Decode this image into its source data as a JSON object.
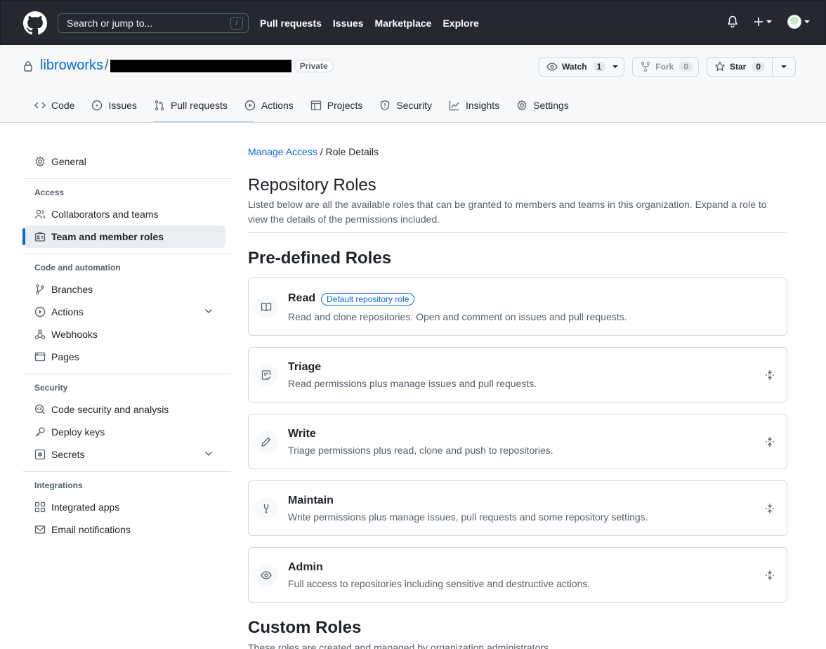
{
  "topbar": {
    "search_placeholder": "Search or jump to...",
    "search_shortcut": "/",
    "nav": [
      "Pull requests",
      "Issues",
      "Marketplace",
      "Explore"
    ],
    "icons": [
      "github-logo-icon",
      "bell-icon",
      "plus-icon",
      "avatar"
    ]
  },
  "repo": {
    "owner": "libroworks",
    "separator": "/",
    "visibility": "Private",
    "watch_label": "Watch",
    "watch_count": "1",
    "fork_label": "Fork",
    "fork_count": "0",
    "star_label": "Star",
    "star_count": "0"
  },
  "tabs": [
    "Code",
    "Issues",
    "Pull requests",
    "Actions",
    "Projects",
    "Security",
    "Insights",
    "Settings"
  ],
  "sidebar": {
    "general": "General",
    "access_heading": "Access",
    "collaborators": "Collaborators and teams",
    "team_roles": "Team and member roles",
    "code_heading": "Code and automation",
    "branches": "Branches",
    "actions": "Actions",
    "webhooks": "Webhooks",
    "pages": "Pages",
    "security_heading": "Security",
    "code_security": "Code security and analysis",
    "deploy_keys": "Deploy keys",
    "secrets": "Secrets",
    "integrations_heading": "Integrations",
    "integrated_apps": "Integrated apps",
    "email_notifications": "Email notifications"
  },
  "main": {
    "breadcrumb_link": "Manage Access",
    "breadcrumb_sep": " / ",
    "breadcrumb_current": "Role Details",
    "title": "Repository Roles",
    "description": "Listed below are all the available roles that can be granted to members and teams in this organization. Expand a role to view the details of the permissions included.",
    "predefined_heading": "Pre-defined Roles",
    "roles": [
      {
        "name": "Read",
        "badge": "Default repository role",
        "desc": "Read and clone repositories. Open and comment on issues and pull requests.",
        "icon": "book-icon"
      },
      {
        "name": "Triage",
        "desc": "Read permissions plus manage issues and pull requests.",
        "icon": "triage-icon"
      },
      {
        "name": "Write",
        "desc": "Triage permissions plus read, clone and push to repositories.",
        "icon": "pencil-icon"
      },
      {
        "name": "Maintain",
        "desc": "Write permissions plus manage issues, pull requests and some repository settings.",
        "icon": "tools-icon"
      },
      {
        "name": "Admin",
        "desc": "Full access to repositories including sensitive and destructive actions.",
        "icon": "eye-icon"
      }
    ],
    "custom_heading": "Custom Roles",
    "custom_desc": "These roles are created and managed by organization administrators."
  }
}
